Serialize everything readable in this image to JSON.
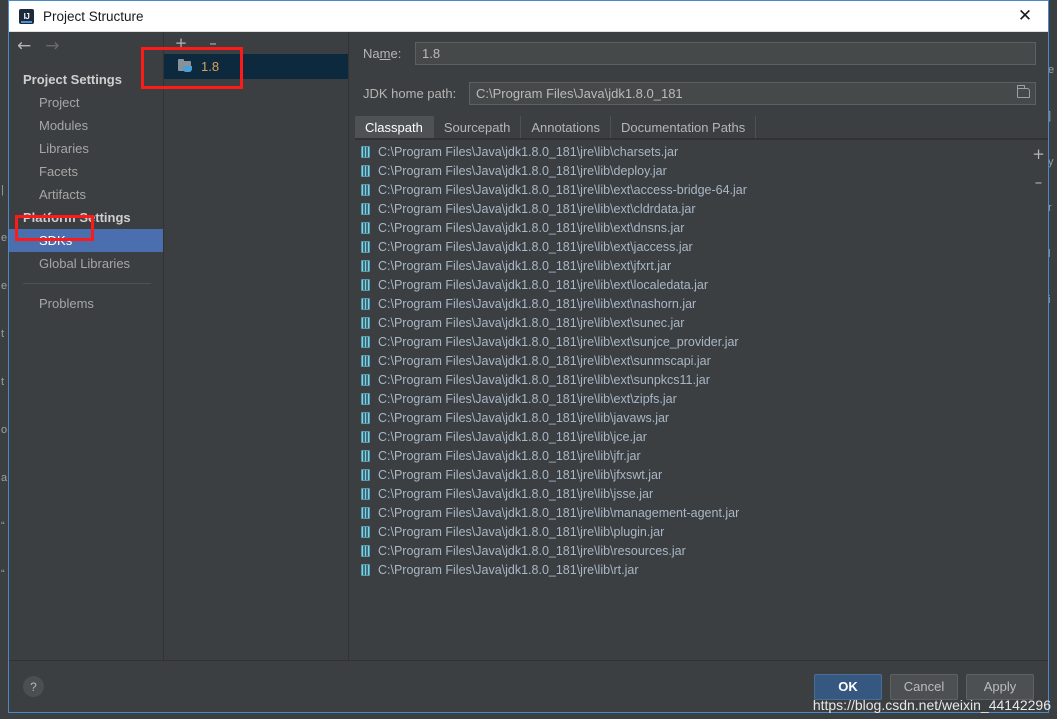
{
  "window": {
    "title": "Project Structure",
    "logo_icon": "intellij-idea-logo",
    "close_icon": "✕"
  },
  "nav": {
    "back_icon": "←",
    "forward_icon": "→"
  },
  "sidebar": {
    "groups": [
      {
        "label": "Project Settings",
        "items": [
          {
            "label": "Project",
            "selected": false
          },
          {
            "label": "Modules",
            "selected": false
          },
          {
            "label": "Libraries",
            "selected": false
          },
          {
            "label": "Facets",
            "selected": false
          },
          {
            "label": "Artifacts",
            "selected": false
          }
        ]
      },
      {
        "label": "Platform Settings",
        "items": [
          {
            "label": "SDKs",
            "selected": true
          },
          {
            "label": "Global Libraries",
            "selected": false
          }
        ]
      }
    ],
    "problems_label": "Problems"
  },
  "sdk_pane": {
    "add_icon": "+",
    "remove_icon": "–",
    "items": [
      {
        "label": "1.8",
        "icon": "jdk-folder-icon",
        "selected": true
      }
    ]
  },
  "detail": {
    "name_label_pre": "Na",
    "name_label_mnemonic": "m",
    "name_label_post": "e:",
    "name_value": "1.8",
    "path_label": "JDK home path:",
    "path_value": "C:\\Program Files\\Java\\jdk1.8.0_181",
    "browse_icon": "folder-icon",
    "tabs": [
      {
        "label": "Classpath",
        "active": true
      },
      {
        "label": "Sourcepath",
        "active": false
      },
      {
        "label": "Annotations",
        "active": false
      },
      {
        "label": "Documentation Paths",
        "active": false
      }
    ],
    "list_add_icon": "+",
    "list_remove_icon": "–",
    "classpath_entries": [
      "C:\\Program Files\\Java\\jdk1.8.0_181\\jre\\lib\\charsets.jar",
      "C:\\Program Files\\Java\\jdk1.8.0_181\\jre\\lib\\deploy.jar",
      "C:\\Program Files\\Java\\jdk1.8.0_181\\jre\\lib\\ext\\access-bridge-64.jar",
      "C:\\Program Files\\Java\\jdk1.8.0_181\\jre\\lib\\ext\\cldrdata.jar",
      "C:\\Program Files\\Java\\jdk1.8.0_181\\jre\\lib\\ext\\dnsns.jar",
      "C:\\Program Files\\Java\\jdk1.8.0_181\\jre\\lib\\ext\\jaccess.jar",
      "C:\\Program Files\\Java\\jdk1.8.0_181\\jre\\lib\\ext\\jfxrt.jar",
      "C:\\Program Files\\Java\\jdk1.8.0_181\\jre\\lib\\ext\\localedata.jar",
      "C:\\Program Files\\Java\\jdk1.8.0_181\\jre\\lib\\ext\\nashorn.jar",
      "C:\\Program Files\\Java\\jdk1.8.0_181\\jre\\lib\\ext\\sunec.jar",
      "C:\\Program Files\\Java\\jdk1.8.0_181\\jre\\lib\\ext\\sunjce_provider.jar",
      "C:\\Program Files\\Java\\jdk1.8.0_181\\jre\\lib\\ext\\sunmscapi.jar",
      "C:\\Program Files\\Java\\jdk1.8.0_181\\jre\\lib\\ext\\sunpkcs11.jar",
      "C:\\Program Files\\Java\\jdk1.8.0_181\\jre\\lib\\ext\\zipfs.jar",
      "C:\\Program Files\\Java\\jdk1.8.0_181\\jre\\lib\\javaws.jar",
      "C:\\Program Files\\Java\\jdk1.8.0_181\\jre\\lib\\jce.jar",
      "C:\\Program Files\\Java\\jdk1.8.0_181\\jre\\lib\\jfr.jar",
      "C:\\Program Files\\Java\\jdk1.8.0_181\\jre\\lib\\jfxswt.jar",
      "C:\\Program Files\\Java\\jdk1.8.0_181\\jre\\lib\\jsse.jar",
      "C:\\Program Files\\Java\\jdk1.8.0_181\\jre\\lib\\management-agent.jar",
      "C:\\Program Files\\Java\\jdk1.8.0_181\\jre\\lib\\plugin.jar",
      "C:\\Program Files\\Java\\jdk1.8.0_181\\jre\\lib\\resources.jar",
      "C:\\Program Files\\Java\\jdk1.8.0_181\\jre\\lib\\rt.jar"
    ]
  },
  "footer": {
    "help_icon": "?",
    "ok_label": "OK",
    "cancel_label": "Cancel",
    "apply_label": "Apply"
  },
  "watermark": "https://blog.csdn.net/weixin_44142296",
  "backdrop": {
    "left_fragments": [
      "|",
      "e",
      "e",
      "t",
      "t",
      "o",
      "a",
      "“",
      "“"
    ],
    "right_fragments": [
      "e",
      "]",
      "y",
      "r",
      "l",
      "i"
    ]
  },
  "colors": {
    "accent_blue": "#4b6eaf",
    "selection_dark": "#0d293e",
    "annotation_red": "#ff1a1a",
    "sdk_label": "#d9a05b",
    "path_text": "#a9b7c6",
    "panel_bg": "#3c3f41"
  }
}
